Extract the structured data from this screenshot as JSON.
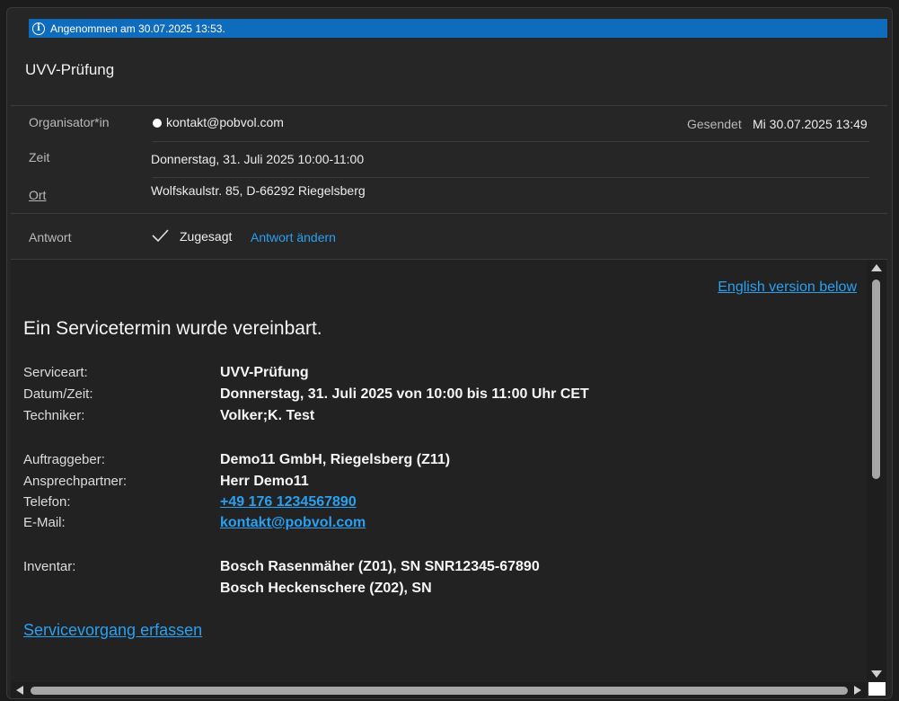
{
  "info_bar": {
    "text": "Angenommen am 30.07.2025 13:53."
  },
  "subject": "UVV-Prüfung",
  "header": {
    "organizer_label": "Organisator*in",
    "organizer_value": "kontakt@pobvol.com",
    "sent_label": "Gesendet",
    "sent_value": "Mi 30.07.2025 13:49",
    "time_label": "Zeit",
    "time_value": "Donnerstag, 31. Juli 2025 10:00-11:00",
    "location_label": "Ort",
    "location_value": "Wolfskaulstr. 85, D-66292 Riegelsberg",
    "response_label": "Antwort",
    "response_value": "Zugesagt",
    "change_response_link": "Antwort ändern"
  },
  "body": {
    "english_link": "English version below",
    "headline": "Ein Servicetermin wurde vereinbart.",
    "fields": [
      {
        "label": "Serviceart:",
        "value": "UVV-Prüfung"
      },
      {
        "label": "Datum/Zeit:",
        "value": "Donnerstag, 31. Juli 2025 von 10:00 bis 11:00 Uhr CET"
      },
      {
        "label": "Techniker:",
        "value": "Volker;K. Test"
      },
      {
        "label": "Auftraggeber:",
        "value": "Demo11 GmbH, Riegelsberg (Z11)"
      },
      {
        "label": "Ansprechpartner:",
        "value": "Herr Demo11"
      },
      {
        "label": "Telefon:",
        "value": "+49 176 1234567890"
      },
      {
        "label": "E-Mail:",
        "value": "kontakt@pobvol.com"
      },
      {
        "label": "Inventar:",
        "value": "Bosch Rasenmäher (Z01), SN SNR12345-67890"
      },
      {
        "label": "",
        "value": "Bosch Heckenschere (Z02), SN"
      }
    ],
    "service_link": "Servicevorgang erfassen"
  },
  "colors": {
    "accent": "#0f6cbd",
    "link": "#2aa0f0",
    "background": "#262626"
  }
}
